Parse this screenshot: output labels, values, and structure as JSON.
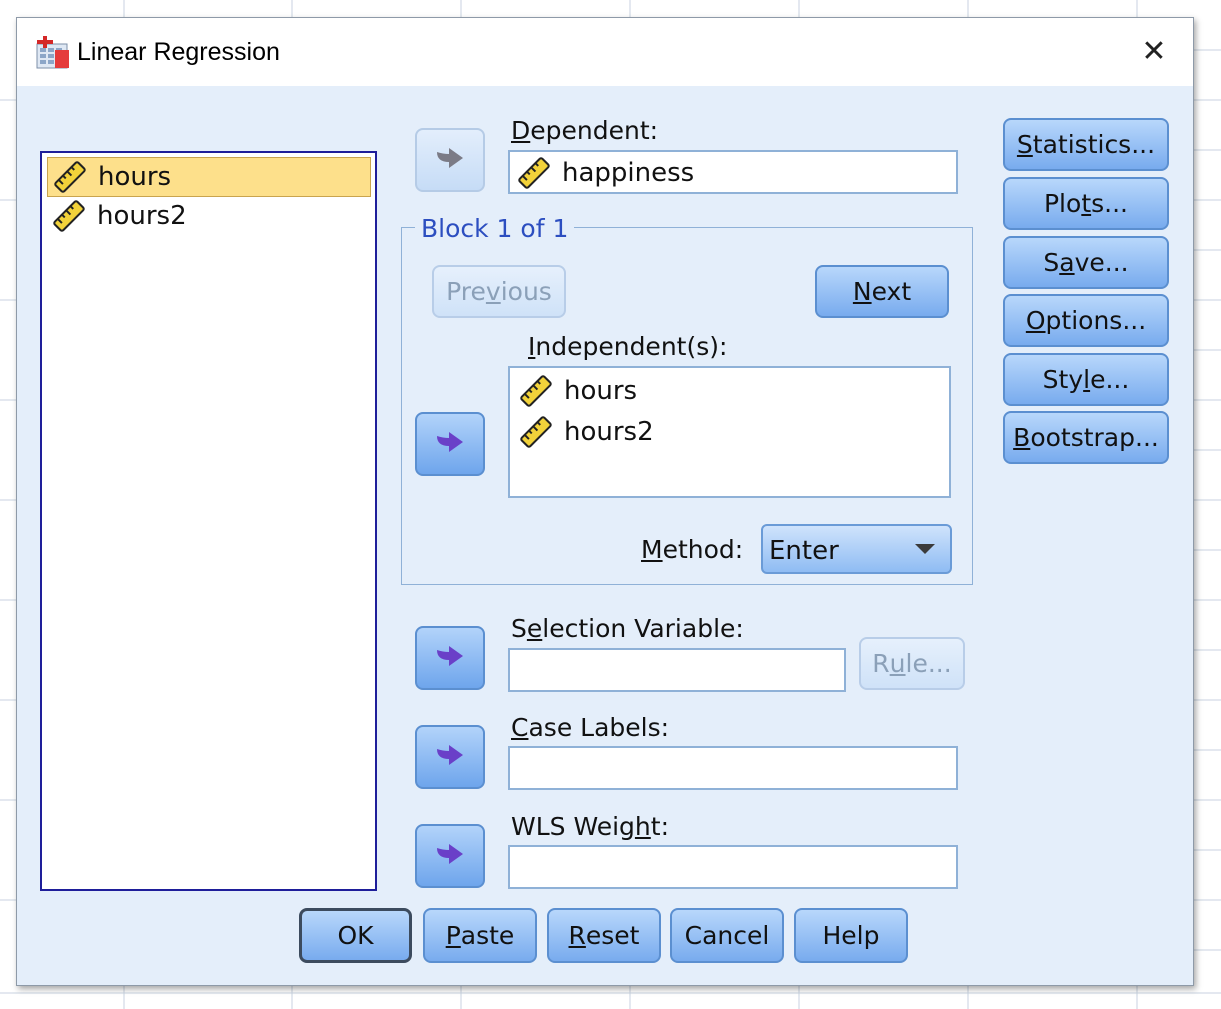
{
  "dialog": {
    "title": "Linear Regression",
    "close_symbol": "✕"
  },
  "source_list": {
    "items": [
      {
        "label": "hours",
        "icon": "ruler-scale-icon",
        "selected": true
      },
      {
        "label": "hours2",
        "icon": "ruler-scale-icon",
        "selected": false
      }
    ]
  },
  "dependent": {
    "label_pre": "",
    "label_ul": "D",
    "label_post": "ependent:",
    "value": "happiness"
  },
  "block": {
    "legend": "Block 1 of 1",
    "previous_pre": "Pre",
    "previous_ul": "v",
    "previous_post": "ious",
    "next_pre": "",
    "next_ul": "N",
    "next_post": "ext"
  },
  "independents": {
    "label_pre": "",
    "label_ul": "I",
    "label_post": "ndependent(s):",
    "items": [
      {
        "label": "hours"
      },
      {
        "label": "hours2"
      }
    ]
  },
  "method": {
    "label_pre": "",
    "label_ul": "M",
    "label_post": "ethod:",
    "value": "Enter"
  },
  "selection_variable": {
    "label_pre": "S",
    "label_ul": "e",
    "label_post": "lection Variable:",
    "value": "",
    "rule_pre": "R",
    "rule_ul": "u",
    "rule_post": "le..."
  },
  "case_labels": {
    "label_pre": "",
    "label_ul": "C",
    "label_post": "ase Labels:",
    "value": ""
  },
  "wls_weight": {
    "label_pre": "WLS Weig",
    "label_ul": "h",
    "label_post": "t:",
    "value": ""
  },
  "side_buttons": [
    {
      "pre": "",
      "ul": "S",
      "post": "tatistics..."
    },
    {
      "pre": "Plo",
      "ul": "t",
      "post": "s..."
    },
    {
      "pre": "S",
      "ul": "a",
      "post": "ve..."
    },
    {
      "pre": "",
      "ul": "O",
      "post": "ptions..."
    },
    {
      "pre": "Sty",
      "ul": "l",
      "post": "e..."
    },
    {
      "pre": "",
      "ul": "B",
      "post": "ootstrap..."
    }
  ],
  "bottom_buttons": [
    {
      "pre": "OK",
      "ul": "",
      "post": ""
    },
    {
      "pre": "",
      "ul": "P",
      "post": "aste"
    },
    {
      "pre": "",
      "ul": "R",
      "post": "eset"
    },
    {
      "pre": "Cancel",
      "ul": "",
      "post": ""
    },
    {
      "pre": "Help",
      "ul": "",
      "post": ""
    }
  ],
  "colors": {
    "dialog_bg": "#e4eefa",
    "button_blue": "#78abee",
    "selection_yellow": "#fde08b",
    "block_legend": "#2c4ec0",
    "arrow_purple": "#6a40c8"
  }
}
